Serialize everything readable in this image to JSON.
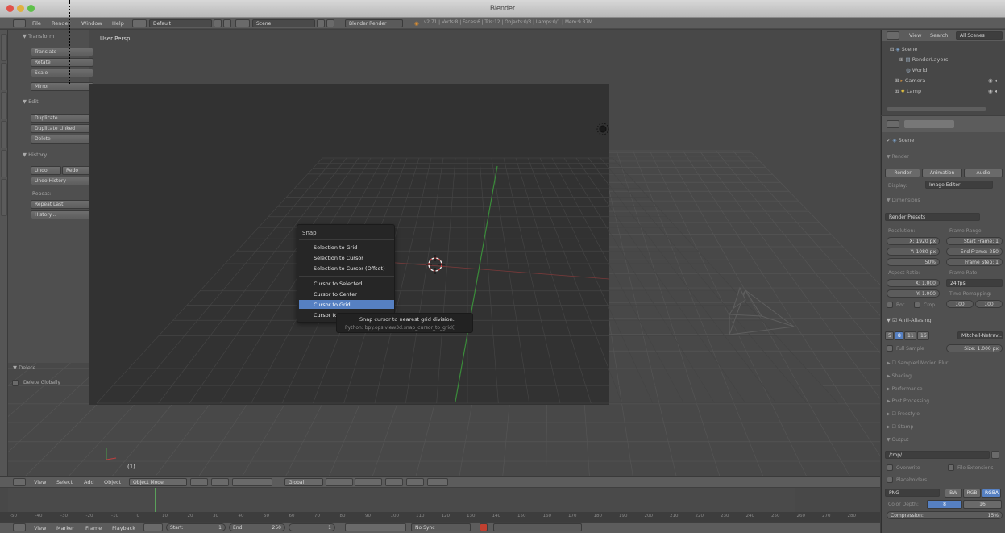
{
  "window": {
    "title": "Blender"
  },
  "info_header": {
    "menus": [
      "File",
      "Render",
      "Window",
      "Help"
    ],
    "layout": "Default",
    "scene": "Scene",
    "engine": "Blender Render",
    "stats": "v2.71 | Verts:8 | Faces:6 | Tris:12 | Objects:0/3 | Lamps:0/1 | Mem:9.87M"
  },
  "viewport": {
    "label": "User Persp",
    "frame_indicator": "(1)"
  },
  "tool_shelf": {
    "tabs": [
      "Tools",
      "Create",
      "Relations",
      "Animation",
      "Physics",
      "Grease Pencil"
    ],
    "transform_header": "Transform",
    "transform_buttons": [
      "Translate",
      "Rotate",
      "Scale"
    ],
    "mirror": "Mirror",
    "edit_header": "Edit",
    "edit_buttons": [
      "Duplicate",
      "Duplicate Linked",
      "Delete"
    ],
    "history_header": "History",
    "undo": "Undo",
    "redo": "Redo",
    "undo_history": "Undo History",
    "repeat_label": "Repeat:",
    "repeat_last": "Repeat Last",
    "history_btn": "History...",
    "operator_header": "Delete",
    "delete_globally": "Delete Globally"
  },
  "snap_menu": {
    "title": "Snap",
    "items": [
      "Selection to Grid",
      "Selection to Cursor",
      "Selection to Cursor (Offset)",
      "Cursor to Selected",
      "Cursor to Center",
      "Cursor to Grid",
      "Cursor to Active"
    ],
    "highlighted": "Cursor to Grid",
    "tooltip": "Snap cursor to nearest grid division.",
    "tooltip_python": "Python: bpy.ops.view3d.snap_cursor_to_grid()"
  },
  "outliner": {
    "menus": [
      "View",
      "Search"
    ],
    "filter": "All Scenes",
    "items": [
      "Scene",
      "RenderLayers",
      "World",
      "Camera",
      "Lamp"
    ]
  },
  "properties": {
    "scene": "Scene",
    "render_header": "Render",
    "render_buttons": [
      "Render",
      "Animation",
      "Audio"
    ],
    "display_label": "Display:",
    "display_value": "Image Editor",
    "dimensions_header": "Dimensions",
    "render_presets": "Render Presets",
    "resolution_label": "Resolution:",
    "res_x": "1920 px",
    "res_y": "1080 px",
    "res_pct": "50%",
    "frame_range_label": "Frame Range:",
    "start_frame": "Start Frame: 1",
    "end_frame": "End Frame: 250",
    "frame_step": "Frame Step: 1",
    "aspect_label": "Aspect Ratio:",
    "aspect_x": "1.000",
    "aspect_y": "1.000",
    "frame_rate_label": "Frame Rate:",
    "fps": "24 fps",
    "time_remap_label": "Time Remapping:",
    "remap_old": "100",
    "remap_new": "100",
    "border": "Bor",
    "crop": "Crop",
    "aa_header": "Anti-Aliasing",
    "aa_samples": [
      "5",
      "8",
      "11",
      "16"
    ],
    "aa_selected": "8",
    "aa_filter": "Mitchell-Netrav...",
    "full_sample": "Full Sample",
    "aa_size": "Size: 1.000 px",
    "collapsed": [
      "Sampled Motion Blur",
      "Shading",
      "Performance",
      "Post Processing",
      "Freestyle",
      "Stamp"
    ],
    "output_header": "Output",
    "output_path": "/tmp/",
    "overwrite": "Overwrite",
    "file_extensions": "File Extensions",
    "placeholders": "Placeholders",
    "format": "PNG",
    "color_modes": [
      "BW",
      "RGB",
      "RGBA"
    ],
    "color_mode_selected": "RGBA",
    "color_depth_label": "Color Depth:",
    "color_depths": [
      "8",
      "16"
    ],
    "compression": "Compression:",
    "compression_value": "15%"
  },
  "view3d_header": {
    "menus": [
      "View",
      "Select",
      "Add",
      "Object"
    ],
    "mode": "Object Mode",
    "orientation": "Global"
  },
  "timeline": {
    "ruler": [
      "-50",
      "-40",
      "-30",
      "-20",
      "-10",
      "0",
      "10",
      "20",
      "30",
      "40",
      "50",
      "60",
      "70",
      "80",
      "90",
      "100",
      "110",
      "120",
      "130",
      "140",
      "150",
      "160",
      "170",
      "180",
      "190",
      "200",
      "210",
      "220",
      "230",
      "240",
      "250",
      "260",
      "270",
      "280"
    ],
    "menus": [
      "View",
      "Marker",
      "Frame",
      "Playback"
    ],
    "start": "Start:",
    "start_value": "1",
    "end": "End:",
    "end_value": "250",
    "current": "1",
    "sync": "No Sync"
  }
}
